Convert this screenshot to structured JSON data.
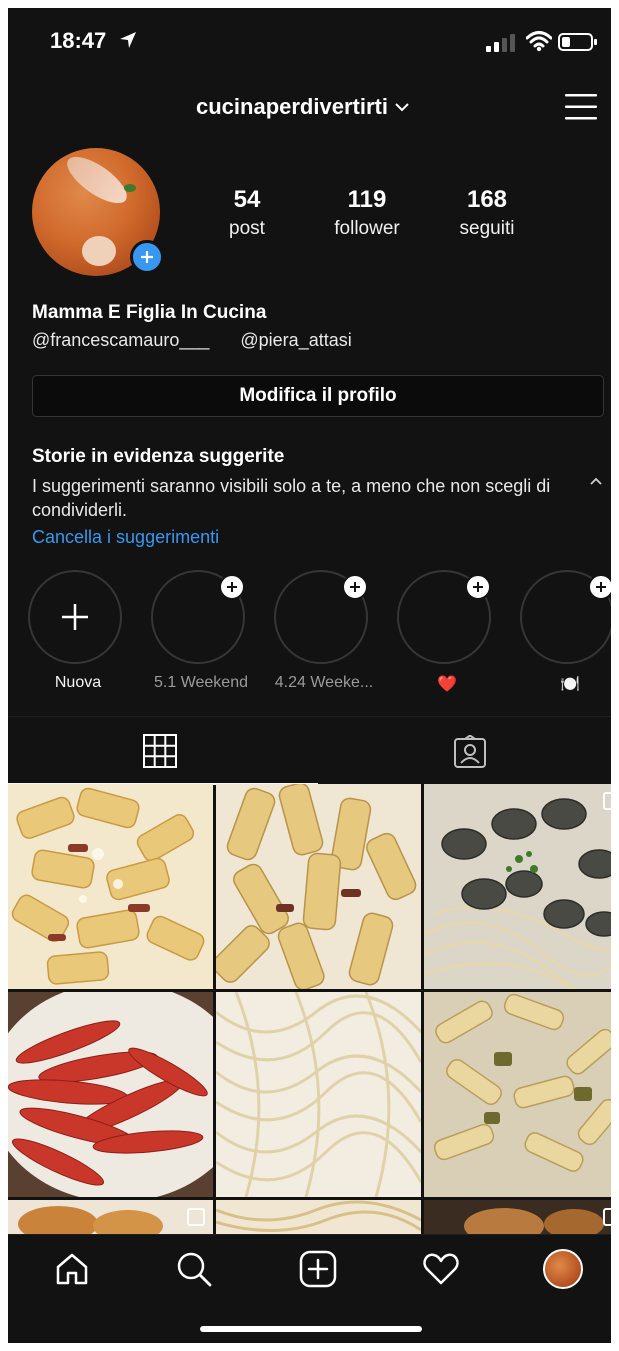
{
  "status_bar": {
    "time": "18:47"
  },
  "header": {
    "username": "cucinaperdivertirti"
  },
  "profile": {
    "stats": [
      {
        "value": "54",
        "label": "post"
      },
      {
        "value": "119",
        "label": "follower"
      },
      {
        "value": "168",
        "label": "seguiti"
      }
    ],
    "name": "Mamma E Figlia In Cucina",
    "handles": [
      "@francescamauro___",
      "@piera_attasi"
    ],
    "edit_label": "Modifica il profilo"
  },
  "suggestions": {
    "title": "Storie in evidenza suggerite",
    "text": "I suggerimenti saranno visibili solo a te, a meno che non scegli di condividerli.",
    "link": "Cancella i suggerimenti"
  },
  "highlights": [
    {
      "label": "Nuova"
    },
    {
      "label": "5.1 Weekend"
    },
    {
      "label": "4.24 Weeke..."
    },
    {
      "label": "❤️"
    },
    {
      "label": "🍽️"
    }
  ],
  "tabs": [
    {
      "icon": "grid-icon",
      "active": true
    },
    {
      "icon": "tagged-icon",
      "active": false
    }
  ],
  "grid_posts": [
    {
      "icon": "rigatoni-carbonara-photo"
    },
    {
      "icon": "rigatoni-guanciale-photo"
    },
    {
      "icon": "spaghetti-vongole-photo"
    },
    {
      "icon": "red-prawns-photo"
    },
    {
      "icon": "spaghetti-cacio-pepe-photo"
    },
    {
      "icon": "fusilli-eggplant-photo"
    }
  ],
  "bottom_nav": [
    {
      "icon": "home-icon"
    },
    {
      "icon": "search-icon"
    },
    {
      "icon": "new-post-icon"
    },
    {
      "icon": "heart-icon"
    },
    {
      "icon": "profile-avatar-icon"
    }
  ],
  "colors": {
    "background": "#121212",
    "accent": "#3897f0",
    "border": "#363636"
  }
}
